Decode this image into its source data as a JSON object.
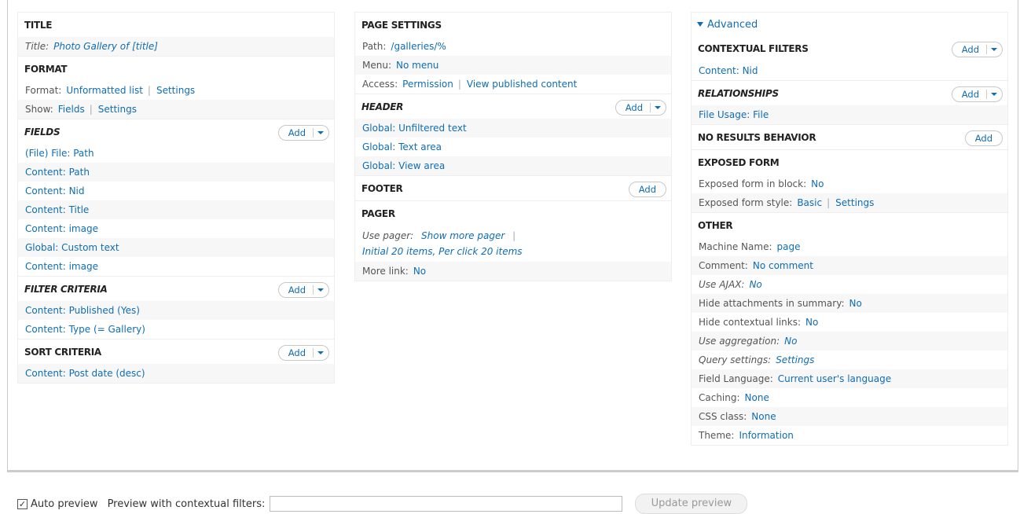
{
  "col1": {
    "title": {
      "heading": "TITLE",
      "label": "Title:",
      "value": "Photo Gallery of [title]"
    },
    "format": {
      "heading": "FORMAT",
      "format_label": "Format:",
      "format_value": "Unformatted list",
      "format_settings": "Settings",
      "show_label": "Show:",
      "show_value": "Fields",
      "show_settings": "Settings"
    },
    "fields": {
      "heading": "FIELDS",
      "add_label": "Add",
      "items": [
        "(File) File: Path",
        "Content: Path",
        "Content: Nid",
        "Content: Title",
        "Content: image",
        "Global: Custom text",
        "Content: image"
      ]
    },
    "filter_criteria": {
      "heading": "FILTER CRITERIA",
      "add_label": "Add",
      "items": [
        "Content: Published (Yes)",
        "Content: Type (= Gallery)"
      ]
    },
    "sort_criteria": {
      "heading": "SORT CRITERIA",
      "add_label": "Add",
      "items": [
        "Content: Post date (desc)"
      ]
    }
  },
  "col2": {
    "page_settings": {
      "heading": "PAGE SETTINGS",
      "path_label": "Path:",
      "path_value": "/galleries/%",
      "menu_label": "Menu:",
      "menu_value": "No menu",
      "access_label": "Access:",
      "access_value": "Permission",
      "access_detail": "View published content"
    },
    "header": {
      "heading": "HEADER",
      "add_label": "Add",
      "items": [
        "Global: Unfiltered text",
        "Global: Text area",
        "Global: View area"
      ]
    },
    "footer": {
      "heading": "FOOTER",
      "add_label": "Add"
    },
    "pager": {
      "heading": "PAGER",
      "use_pager_label": "Use pager:",
      "use_pager_value": "Show more pager",
      "pager_detail": "Initial 20 items, Per click 20 items",
      "more_link_label": "More link:",
      "more_link_value": "No"
    }
  },
  "col3": {
    "advanced_label": "Advanced",
    "contextual_filters": {
      "heading": "CONTEXTUAL FILTERS",
      "add_label": "Add",
      "items": [
        "Content: Nid"
      ]
    },
    "relationships": {
      "heading": "RELATIONSHIPS",
      "add_label": "Add",
      "items": [
        "File Usage: File"
      ]
    },
    "no_results": {
      "heading": "NO RESULTS BEHAVIOR",
      "add_label": "Add"
    },
    "exposed_form": {
      "heading": "EXPOSED FORM",
      "in_block_label": "Exposed form in block:",
      "in_block_value": "No",
      "style_label": "Exposed form style:",
      "style_value": "Basic",
      "style_settings": "Settings"
    },
    "other": {
      "heading": "OTHER",
      "rows": [
        {
          "label": "Machine Name:",
          "value": "page"
        },
        {
          "label": "Comment:",
          "value": "No comment"
        },
        {
          "label": "Use AJAX:",
          "value": "No"
        },
        {
          "label": "Hide attachments in summary:",
          "value": "No"
        },
        {
          "label": "Hide contextual links:",
          "value": "No"
        },
        {
          "label": "Use aggregation:",
          "value": "No"
        },
        {
          "label": "Query settings:",
          "value": "Settings"
        },
        {
          "label": "Field Language:",
          "value": "Current user's language"
        },
        {
          "label": "Caching:",
          "value": "None"
        },
        {
          "label": "CSS class:",
          "value": "None"
        },
        {
          "label": "Theme:",
          "value": "Information"
        }
      ]
    }
  },
  "preview": {
    "auto_preview_label": "Auto preview",
    "auto_preview_checked": true,
    "contextual_filters_label": "Preview with contextual filters:",
    "contextual_filters_value": "",
    "update_button": "Update preview"
  }
}
